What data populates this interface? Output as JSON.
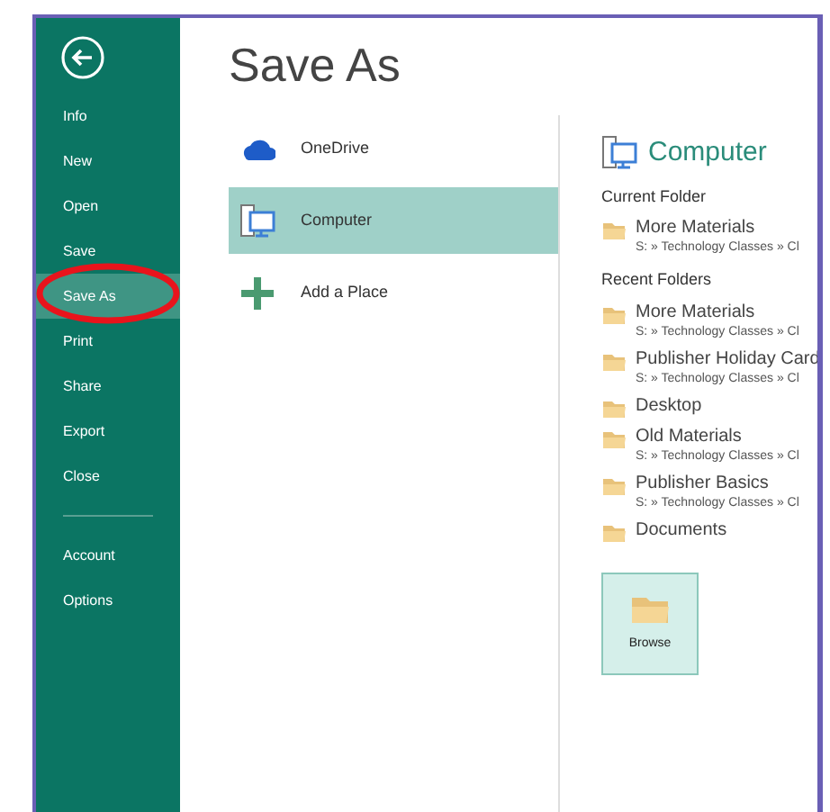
{
  "sidebar": {
    "items": [
      {
        "label": "Info",
        "selected": false
      },
      {
        "label": "New",
        "selected": false
      },
      {
        "label": "Open",
        "selected": false
      },
      {
        "label": "Save",
        "selected": false
      },
      {
        "label": "Save As",
        "selected": true
      },
      {
        "label": "Print",
        "selected": false
      },
      {
        "label": "Share",
        "selected": false
      },
      {
        "label": "Export",
        "selected": false
      },
      {
        "label": "Close",
        "selected": false
      },
      {
        "kind": "divider"
      },
      {
        "label": "Account",
        "selected": false
      },
      {
        "label": "Options",
        "selected": false
      }
    ]
  },
  "title": "Save As",
  "places": [
    {
      "label": "OneDrive",
      "kind": "cloud",
      "selected": false
    },
    {
      "label": "Computer",
      "kind": "computer",
      "selected": true
    },
    {
      "label": "Add a Place",
      "kind": "add",
      "selected": false
    }
  ],
  "location": {
    "heading": "Computer",
    "sections": [
      {
        "title": "Current Folder",
        "folders": [
          {
            "name": "More Materials",
            "path": "S: » Technology Classes » Cl"
          }
        ]
      },
      {
        "title": "Recent Folders",
        "folders": [
          {
            "name": "More Materials",
            "path": "S: » Technology Classes » Cl"
          },
          {
            "name": "Publisher Holiday Card",
            "path": "S: » Technology Classes » Cl"
          },
          {
            "name": "Desktop"
          },
          {
            "name": "Old Materials",
            "path": "S: » Technology Classes » Cl"
          },
          {
            "name": "Publisher Basics",
            "path": "S: » Technology Classes » Cl"
          },
          {
            "name": "Documents"
          }
        ]
      }
    ],
    "browse_button": "Browse"
  },
  "annotation": {
    "kind": "ellipse"
  }
}
